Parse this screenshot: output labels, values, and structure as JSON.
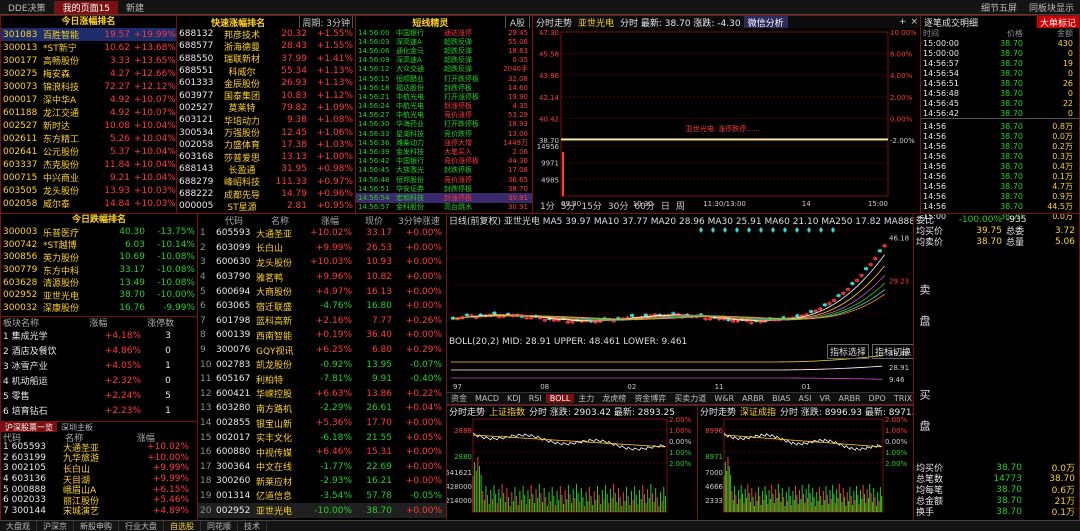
{
  "top_tabs": [
    "DDE决策",
    "我的页面15",
    "新建"
  ],
  "top_right": [
    "细节五屏",
    "同板块显示"
  ],
  "rank_up": {
    "title": "今日涨幅排名",
    "rows": [
      [
        "301083",
        "百胜智能",
        "19.57",
        "+19.99%"
      ],
      [
        "300013",
        "*ST新宁",
        "10.62",
        "+13.68%"
      ],
      [
        "300177",
        "高畅股份",
        "3.33",
        "+13.65%"
      ],
      [
        "300275",
        "梅安森",
        "4.27",
        "+12.66%"
      ],
      [
        "300073",
        "锦浪科技",
        "72.27",
        "+12.12%"
      ],
      [
        "000017",
        "深中华A",
        "4.92",
        "+10.07%"
      ],
      [
        "601188",
        "龙江交通",
        "4.92",
        "+10.07%"
      ],
      [
        "002527",
        "新时达",
        "10.08",
        "+10.04%"
      ],
      [
        "002611",
        "东方精工",
        "5.26",
        "+10.04%"
      ],
      [
        "002641",
        "公元股份",
        "5.37",
        "+10.04%"
      ],
      [
        "603337",
        "杰克股份",
        "11.84",
        "+10.04%"
      ],
      [
        "000715",
        "中兴商业",
        "9.21",
        "+10.04%"
      ],
      [
        "603505",
        "龙头股份",
        "13.93",
        "+10.03%"
      ],
      [
        "002058",
        "威尔泰",
        "14.84",
        "+10.03%"
      ]
    ]
  },
  "rank_down": {
    "title": "今日跌幅排名",
    "rows": [
      [
        "300003",
        "乐普医疗",
        "40.30",
        "-13.75%"
      ],
      [
        "300742",
        "*ST越博",
        "6.03",
        "-10.14%"
      ],
      [
        "300856",
        "英力股份",
        "10.69",
        "-10.08%"
      ],
      [
        "300779",
        "东方中科",
        "33.17",
        "-10.08%"
      ],
      [
        "603628",
        "清源股份",
        "13.49",
        "-10.08%"
      ],
      [
        "002952",
        "亚世光电",
        "38.70",
        "-10.00%"
      ],
      [
        "300032",
        "深康股份",
        "16.76",
        "-9.99%"
      ]
    ]
  },
  "speed": {
    "title": "快速涨幅排名",
    "period": "周期: 3分钟",
    "rows": [
      [
        "688132",
        "邦彦技术",
        "20.32",
        "+1.55%"
      ],
      [
        "688577",
        "浙海德曼",
        "28.43",
        "+1.55%"
      ],
      [
        "688550",
        "瑞联新材",
        "37.99",
        "+1.41%"
      ],
      [
        "688551",
        "科威尔",
        "55.34",
        "+1.13%"
      ],
      [
        "601333",
        "金辰股份",
        "26.93",
        "+1.13%"
      ],
      [
        "603977",
        "国泰集团",
        "10.83",
        "+1.12%"
      ],
      [
        "002527",
        "莫莱特",
        "79.82",
        "+1.09%"
      ],
      [
        "603121",
        "华培动力",
        "9.38",
        "+1.08%"
      ],
      [
        "300534",
        "万强股份",
        "12.45",
        "+1.06%"
      ],
      [
        "002058",
        "力盛体育",
        "17.38",
        "+1.03%"
      ],
      [
        "603168",
        "莎普爱思",
        "13.13",
        "+1.00%"
      ],
      [
        "688143",
        "长盈通",
        "31.95",
        "+0.98%"
      ],
      [
        "688279",
        "峰岹科技",
        "111.33",
        "+0.97%"
      ],
      [
        "688222",
        "成都先导",
        "14.79",
        "+0.96%"
      ],
      [
        "000005",
        "ST星源",
        "2.81",
        "+0.95%"
      ]
    ]
  },
  "sector": {
    "headers": [
      "板块名称",
      "涨幅",
      "涨停数"
    ],
    "rows": [
      [
        "集成光学",
        "+4.18%",
        "3"
      ],
      [
        "酒店及餐饮",
        "+4.86%",
        "0"
      ],
      [
        "冰雪产业",
        "+4.05%",
        "1"
      ],
      [
        "机动船运",
        "+2.32%",
        "0"
      ],
      [
        "零售",
        "+2.24%",
        "5"
      ],
      [
        "培育钻石",
        "+2.23%",
        "1"
      ]
    ],
    "sub_tabs": [
      "沪深股票一览",
      "深圳主板"
    ],
    "sub_headers": [
      "代码",
      "名称",
      "涨幅"
    ],
    "sub_rows": [
      [
        "605593",
        "大通圣亚",
        "+10.02%"
      ],
      [
        "603199",
        "九华旅游",
        "+10.00%"
      ],
      [
        "002105",
        "长白山",
        "+9.99%"
      ],
      [
        "603136",
        "天目湖",
        "+9.99%"
      ],
      [
        "000888",
        "峨眉山A",
        "+6.15%"
      ],
      [
        "002033",
        "丽江股份",
        "+5.46%"
      ],
      [
        "300144",
        "宋城演艺",
        "+4.89%"
      ]
    ]
  },
  "main_list": {
    "headers": [
      "代码",
      "名称",
      "涨幅",
      "现价",
      "3分钟涨速"
    ],
    "rows": [
      [
        "1",
        "605593",
        "大通圣亚",
        "+10.02%",
        "33.17",
        "+0.00%"
      ],
      [
        "2",
        "603099",
        "长白山",
        "+9.99%",
        "26.53",
        "+0.00%"
      ],
      [
        "3",
        "600630",
        "龙头股份",
        "+10.03%",
        "10.93",
        "+0.00%"
      ],
      [
        "4",
        "603790",
        "雅茗鸭",
        "+9.96%",
        "10.82",
        "+0.00%"
      ],
      [
        "5",
        "600694",
        "大商股份",
        "+4.97%",
        "16.13",
        "+0.00%"
      ],
      [
        "6",
        "603065",
        "宿迁联盛",
        "-4.76%",
        "16.80",
        "+0.00%"
      ],
      [
        "7",
        "601798",
        "蓝科高新",
        "+2.16%",
        "7.77",
        "+0.26%"
      ],
      [
        "8",
        "600139",
        "西南智能",
        "+0.19%",
        "36.40",
        "+0.00%"
      ],
      [
        "9",
        "300076",
        "GQY视讯",
        "+6.25%",
        "6.80",
        "+0.29%"
      ],
      [
        "10",
        "002783",
        "凯龙股份",
        "-0.92%",
        "13.95",
        "-0.07%"
      ],
      [
        "11",
        "605167",
        "利柏特",
        "-7.81%",
        "9.91",
        "-0.40%"
      ],
      [
        "12",
        "600421",
        "华嵘控股",
        "+6.63%",
        "13.86",
        "+0.22%"
      ],
      [
        "13",
        "603280",
        "南方路机",
        "-2.29%",
        "26.61",
        "+0.04%"
      ],
      [
        "14",
        "002855",
        "银宝山新",
        "+5.36%",
        "17.70",
        "+0.00%"
      ],
      [
        "15",
        "002017",
        "实丰文化",
        "-6.18%",
        "21.55",
        "+0.05%"
      ],
      [
        "16",
        "600880",
        "中视传媒",
        "+6.46%",
        "15.31",
        "+0.00%"
      ],
      [
        "17",
        "300364",
        "中文在线",
        "-1.77%",
        "22.69",
        "+0.00%"
      ],
      [
        "18",
        "300260",
        "新莱应材",
        "-2.93%",
        "16.21",
        "+0.00%"
      ],
      [
        "19",
        "001314",
        "亿道信息",
        "-3.54%",
        "57.78",
        "-0.05%"
      ],
      [
        "20",
        "002952",
        "亚世光电",
        "-10.00%",
        "38.70",
        "+0.00%"
      ]
    ]
  },
  "sprite": {
    "title": "短线精灵",
    "filter": "A股",
    "rows": [
      [
        "14:56:00",
        "中国银行",
        "通达涨停",
        "29.45"
      ],
      [
        "14:56:03",
        "深高速A",
        "超跌反弹",
        "55.06"
      ],
      [
        "14:56:06",
        "通化金马",
        "超跌反弹",
        "18.63"
      ],
      [
        "14:56:09",
        "深高速A",
        "超跌反弹",
        "0.35"
      ],
      [
        "14:56:12",
        "大众交通",
        "超跌反弹",
        "2040手"
      ],
      [
        "14:56:15",
        "恒顺醋业",
        "打开跌停板",
        "32.08"
      ],
      [
        "14:56:18",
        "福达股份",
        "封跌停板",
        "14.60"
      ],
      [
        "14:56:21",
        "中航光电",
        "打开涨停板",
        "19.90"
      ],
      [
        "14:56:24",
        "中航光电",
        "封涨停板",
        "4.35"
      ],
      [
        "14:56:27",
        "中航光电",
        "竞价涨停",
        "53.29"
      ],
      [
        "14:56:30",
        "华海药业",
        "打开跌停板",
        "18.93"
      ],
      [
        "14:56:33",
        "星湖科技",
        "竞价跌停",
        "13.00"
      ],
      [
        "14:56:36",
        "潍柴动力",
        "涨停大增",
        "1449万"
      ],
      [
        "14:56:39",
        "金发科技",
        "大笔买入",
        "2.06"
      ],
      [
        "14:56:42",
        "中国银行",
        "竞价涨停板",
        "44.36"
      ],
      [
        "14:56:45",
        "大族激光",
        "封跌停板",
        "17.08"
      ],
      [
        "14:56:48",
        "恒邦股份",
        "竞价涨停",
        "36.65"
      ],
      [
        "14:56:51",
        "华安证券",
        "封跌停板",
        "38.70"
      ],
      [
        "14:56:54",
        "宏和科技",
        "封涨停板",
        "30.91"
      ],
      [
        "14:56:57",
        "金科股份",
        "高台跳水",
        "30.91"
      ]
    ]
  },
  "intraday": {
    "title": "分时走势",
    "stock": "亚世光电",
    "info": "分时 最新: 38.70 涨跌: -4.30",
    "tag": "微信分析",
    "left_ticks": [
      "47.30",
      "45.58",
      "43.86",
      "42.14",
      "40.42",
      "38.70",
      "14956",
      "9971",
      "4985"
    ],
    "right_ticks": [
      "10.00%",
      "6.00%",
      "4.00%",
      "2.00%",
      "0.00%",
      "-2.00%"
    ],
    "time_ticks": [
      "09:30",
      "10:30",
      "11:30/13:00",
      "14",
      "15:00"
    ],
    "annotation": "亚世光电: 涨停跌停……"
  },
  "kline": {
    "period_tabs": [
      "1分",
      "5分",
      "15分",
      "30分",
      "60分",
      "日",
      "周"
    ],
    "ma_text": "日线(前复权) 亚世光电 MA5 39.97  MA10 37.77  MA20 28.96  MA30 25.91  MA60 21.10  MA250 17.82  MA888 15.36",
    "high": "46.18",
    "low": "29.23",
    "tags": [
      "指标选择",
      "指标切换"
    ],
    "boll_text": "BOLL(20,2) MID: 28.91  UPPER: 48.461  LOWER: 9.461",
    "boll_ticks": [
      "48.46",
      "28.91",
      "9.46"
    ],
    "date_ticks": [
      "97",
      "08",
      "02",
      "11",
      "01"
    ],
    "ind_tabs": [
      "资金",
      "MACD",
      "KDJ",
      "RSI",
      "BOLL",
      "主力",
      "龙虎榜",
      "资金博弈",
      "买卖力道",
      "W&R",
      "ARBR",
      "BIAS",
      "ASI",
      "VR",
      "ARBR",
      "DPO",
      "TRIX",
      "DMA",
      "BBI"
    ]
  },
  "index_sh": {
    "title": "分时走势",
    "name": "上证指数",
    "info": "分时 涨跌: 2903.42 最新: 2893.25",
    "left_ticks": [
      "2888",
      "2880",
      "6641621",
      "4428000",
      "2214000"
    ],
    "right_ticks": [
      "2.00%",
      "1.00%",
      "0.00%",
      "1.00%",
      "2.00%"
    ]
  },
  "index_sz": {
    "title": "分时走势",
    "name": "深证成指",
    "info": "分时 涨跌: 8996.93 最新: 8971.72",
    "left_ticks": [
      "8996",
      "8971",
      "7000",
      "4666",
      "2333"
    ],
    "right_ticks": [
      "2.00%",
      "1.00%",
      "0.00%",
      "1.00%",
      "2.00%"
    ]
  },
  "ticks_panel": {
    "title": "逐笔成交明细",
    "badge": "大单标记",
    "headers": [
      "时间",
      "价格",
      "金额"
    ],
    "rows": [
      [
        "15:00:00",
        "38.70",
        "430"
      ],
      [
        "15:00:00",
        "38.70",
        "0"
      ],
      [
        "14:56:57",
        "38.70",
        "19"
      ],
      [
        "14:56:54",
        "38.70",
        "0"
      ],
      [
        "14:56:51",
        "38.70",
        "26"
      ],
      [
        "14:56:48",
        "38.70",
        "0"
      ],
      [
        "14:56:45",
        "38.70",
        "22"
      ],
      [
        "14:56:42",
        "38.70",
        "0"
      ]
    ],
    "big_rows": [
      [
        "14:56",
        "38.70",
        "0.8万"
      ],
      [
        "14:56",
        "38.70",
        "0.0万"
      ],
      [
        "14:56",
        "38.70",
        "0.2万"
      ],
      [
        "14:56",
        "38.70",
        "0.3万"
      ],
      [
        "14:56",
        "38.70",
        "0.4万"
      ],
      [
        "14:56",
        "38.70",
        "0.1万"
      ],
      [
        "14:56",
        "38.70",
        "4.7万"
      ],
      [
        "14:56",
        "38.70",
        "0.9万"
      ],
      [
        "14:56",
        "38.70",
        "44.5万"
      ],
      [
        "15:00",
        "38.70",
        "0.0万"
      ]
    ]
  },
  "quote": {
    "rows": [
      [
        "委比",
        "-100.00%",
        "-935"
      ],
      [
        "均买价",
        "39.75",
        "总委",
        "3.72"
      ],
      [
        "均卖价",
        "38.70",
        "总量",
        "5.06"
      ]
    ],
    "side_sell": "卖盘",
    "side_buy": "买盘",
    "bottom": [
      [
        "均买价",
        "38.70",
        "0.0万"
      ],
      [
        "总笔数",
        "14773",
        "38.70"
      ],
      [
        "均每笔",
        "38.70",
        "0.6万"
      ],
      [
        "总金额",
        "38.70",
        "21万"
      ],
      [
        "换手",
        "38.70",
        "0.1万"
      ]
    ]
  },
  "footer_tabs": [
    "大盘观",
    "沪深京",
    "新股申购",
    "行业大盘",
    "自选股",
    "同花顺",
    "技术"
  ],
  "colors": {
    "up": "#ff3a3a",
    "down": "#21d021",
    "yellow": "#ffd21a",
    "frame": "#7a1010"
  }
}
